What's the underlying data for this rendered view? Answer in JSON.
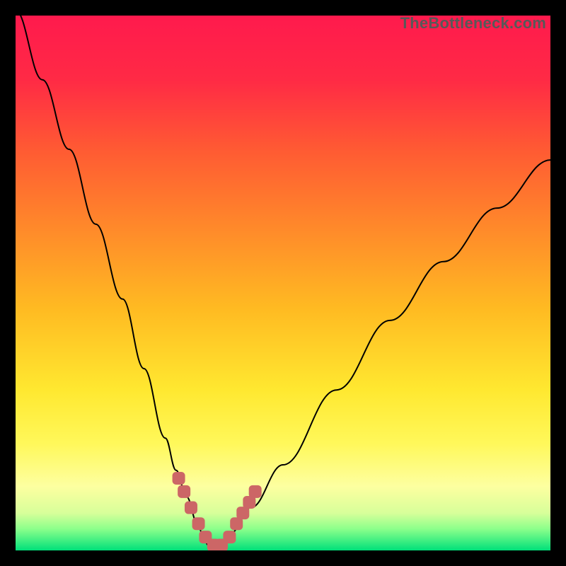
{
  "watermark": "TheBottleneck.com",
  "chart_data": {
    "type": "line",
    "title": "",
    "xlabel": "",
    "ylabel": "",
    "xlim": [
      0,
      100
    ],
    "ylim": [
      0,
      100
    ],
    "curve": {
      "x": [
        0,
        5,
        10,
        15,
        20,
        24,
        28,
        30,
        32,
        34,
        35,
        36,
        37,
        38,
        40,
        44,
        50,
        60,
        70,
        80,
        90,
        100
      ],
      "y": [
        101,
        88,
        75,
        61,
        47,
        34,
        21,
        15,
        10,
        5,
        3,
        1,
        0.5,
        1,
        3,
        8,
        16,
        30,
        43,
        54,
        64,
        73
      ]
    },
    "markers": {
      "x": [
        30.5,
        31.5,
        32.8,
        34.2,
        35.5,
        37.0,
        38.5,
        40.0,
        41.3,
        42.5,
        43.7,
        44.8
      ],
      "y": [
        13.5,
        11.0,
        8.0,
        5.0,
        2.5,
        1.0,
        1.0,
        2.5,
        5.0,
        7.0,
        9.0,
        11.0
      ]
    },
    "marker_style": {
      "color": "#cc6666",
      "shape": "rounded-square",
      "size": 18
    },
    "green_band": {
      "y_top": 4,
      "y_bottom": 0
    },
    "gradient_stops": [
      {
        "offset": 0.0,
        "color": "#ff1a4d"
      },
      {
        "offset": 0.12,
        "color": "#ff2a45"
      },
      {
        "offset": 0.25,
        "color": "#ff5a33"
      },
      {
        "offset": 0.4,
        "color": "#ff8a2a"
      },
      {
        "offset": 0.55,
        "color": "#ffbb22"
      },
      {
        "offset": 0.7,
        "color": "#ffe830"
      },
      {
        "offset": 0.8,
        "color": "#fff85a"
      },
      {
        "offset": 0.88,
        "color": "#fdffa0"
      },
      {
        "offset": 0.93,
        "color": "#d8ff9a"
      },
      {
        "offset": 0.96,
        "color": "#8bff8b"
      },
      {
        "offset": 1.0,
        "color": "#00e07a"
      }
    ]
  }
}
